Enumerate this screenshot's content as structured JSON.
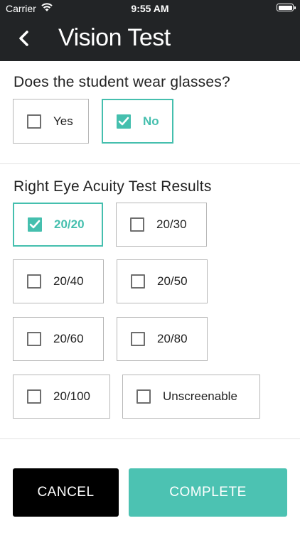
{
  "status_bar": {
    "carrier": "Carrier",
    "time": "9:55 AM"
  },
  "nav": {
    "title": "Vision Test",
    "back_icon": "chevron-left-icon"
  },
  "glasses_section": {
    "title": "Does the student wear glasses?",
    "options": [
      {
        "label": "Yes",
        "checked": false
      },
      {
        "label": "No",
        "checked": true
      }
    ]
  },
  "acuity_section": {
    "title": "Right Eye Acuity Test Results",
    "options": [
      {
        "label": "20/20",
        "checked": true
      },
      {
        "label": "20/30",
        "checked": false
      },
      {
        "label": "20/40",
        "checked": false
      },
      {
        "label": "20/50",
        "checked": false
      },
      {
        "label": "20/60",
        "checked": false
      },
      {
        "label": "20/80",
        "checked": false
      },
      {
        "label": "20/100",
        "checked": false
      },
      {
        "label": "Unscreenable",
        "checked": false
      }
    ]
  },
  "actions": {
    "cancel_label": "CANCEL",
    "complete_label": "COMPLETE"
  },
  "colors": {
    "accent": "#45bfae",
    "header_bg": "#222426",
    "cancel_bg": "#000000",
    "complete_bg": "#4cc2b2"
  }
}
